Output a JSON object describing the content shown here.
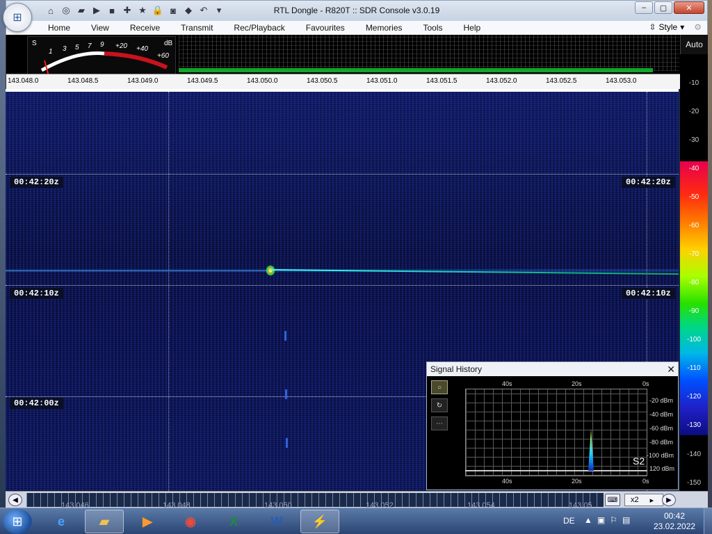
{
  "window": {
    "title": "RTL Dongle - R820T :: SDR Console v3.0.19",
    "controls": {
      "minimize": "–",
      "maximize": "▢",
      "close": "✕"
    }
  },
  "quick_access": [
    {
      "name": "home-icon",
      "glyph": "⌂"
    },
    {
      "name": "lifebuoy-icon",
      "glyph": "◎"
    },
    {
      "name": "folder-icon",
      "glyph": "▰"
    },
    {
      "name": "play-icon",
      "glyph": "▶"
    },
    {
      "name": "stop-icon",
      "glyph": "■"
    },
    {
      "name": "add-icon",
      "glyph": "✚"
    },
    {
      "name": "star-icon",
      "glyph": "★"
    },
    {
      "name": "lock-icon",
      "glyph": "🔒"
    },
    {
      "name": "camera-icon",
      "glyph": "◙"
    },
    {
      "name": "drop-icon",
      "glyph": "◆"
    },
    {
      "name": "undo-icon",
      "glyph": "↶"
    },
    {
      "name": "dropdown-icon",
      "glyph": "▾"
    }
  ],
  "menu": {
    "items": [
      "Home",
      "View",
      "Receive",
      "Transmit",
      "Rec/Playback",
      "Favourites",
      "Memories",
      "Tools",
      "Help"
    ],
    "style_label": "Style"
  },
  "smeter": {
    "s_label": "S",
    "db_label": "dB",
    "s_ticks": [
      "1",
      "3",
      "5",
      "7",
      "9"
    ],
    "db_ticks": [
      "+20",
      "+40",
      "+60"
    ]
  },
  "freq_scale": [
    "143.048.0",
    "143.048.5",
    "143.049.0",
    "143.049.5",
    "143.050.0",
    "143.050.5",
    "143.051.0",
    "143.051.5",
    "143.052.0",
    "143.052.5",
    "143.053.0"
  ],
  "auto_label": "Auto",
  "db_scale": {
    "upper": [
      "-10",
      "-20",
      "-30"
    ],
    "colored": [
      "-40",
      "-50",
      "-60",
      "-70",
      "-80",
      "-90",
      "-100",
      "-110",
      "-120",
      "-130"
    ],
    "lower": [
      "-140",
      "-150"
    ]
  },
  "waterfall": {
    "time_labels": [
      "00:42:20z",
      "00:42:10z",
      "00:42:00z"
    ]
  },
  "signal_history": {
    "title": "Signal History",
    "close": "✕",
    "top_axis": [
      "40s",
      "20s",
      "0s"
    ],
    "bottom_axis": [
      "40s",
      "20s",
      "0s"
    ],
    "dbm_axis": [
      "-20 dBm",
      "-40 dBm",
      "-60 dBm",
      "-80 dBm",
      "-100 dBm",
      "120 dBm"
    ],
    "s_reading": "S2",
    "tools": [
      {
        "name": "record-toggle-icon",
        "glyph": "○"
      },
      {
        "name": "reset-icon",
        "glyph": "↻"
      },
      {
        "name": "more-icon",
        "glyph": "⋯"
      }
    ]
  },
  "bottom_bar": {
    "labels": [
      "143.046",
      "143.048",
      "143.050",
      "143.052",
      "143.054",
      "143.05"
    ],
    "zoom": "x2"
  },
  "taskbar": {
    "apps": [
      {
        "name": "internet-explorer-icon",
        "glyph": "e",
        "color": "#4aa3ff"
      },
      {
        "name": "file-explorer-icon",
        "glyph": "▰",
        "color": "#f0c050",
        "active": true
      },
      {
        "name": "media-player-icon",
        "glyph": "▶",
        "color": "#ff9a2a"
      },
      {
        "name": "chrome-icon",
        "glyph": "◉",
        "color": "#e84c3d"
      },
      {
        "name": "excel-icon",
        "glyph": "X",
        "color": "#1f8a3c"
      },
      {
        "name": "word-icon",
        "glyph": "W",
        "color": "#2a5db0"
      },
      {
        "name": "sdr-console-icon",
        "glyph": "⚡",
        "color": "#d03030",
        "active": true
      }
    ],
    "language": "DE",
    "time": "00:42",
    "date": "23.02.2022"
  }
}
